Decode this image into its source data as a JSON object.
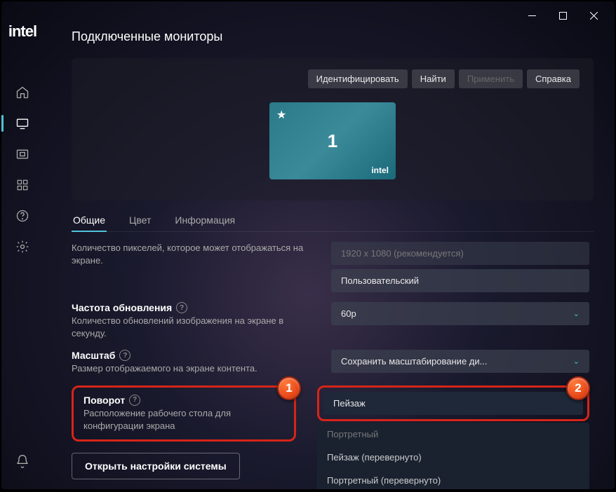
{
  "brand": "intel",
  "page_title": "Подключенные мониторы",
  "panel_buttons": {
    "identify": "Идентифицировать",
    "find": "Найти",
    "apply": "Применить",
    "help": "Справка"
  },
  "monitor": {
    "number": "1",
    "brand": "intel"
  },
  "tabs": [
    "Общие",
    "Цвет",
    "Информация"
  ],
  "settings": {
    "pixels_desc": "Количество пикселей, которое может отображаться на экране.",
    "resolution_options": [
      "1920 x 1080 (рекомендуется)",
      "Пользовательский"
    ],
    "refresh": {
      "title": "Частота обновления",
      "desc": "Количество обновлений изображения на экране в секунду.",
      "value": "60p"
    },
    "scale": {
      "title": "Масштаб",
      "desc": "Размер отображаемого на экране контента.",
      "value": "Сохранить масштабирование ди..."
    },
    "rotation": {
      "title": "Поворот",
      "desc": "Расположение рабочего стола для конфигурации экрана",
      "selected": "Пейзаж",
      "options": [
        "Пейзаж",
        "Портретный",
        "Пейзаж (перевернуто)",
        "Портретный (перевернуто)"
      ]
    }
  },
  "system_settings_btn": "Открыть настройки системы",
  "badges": {
    "one": "1",
    "two": "2"
  }
}
